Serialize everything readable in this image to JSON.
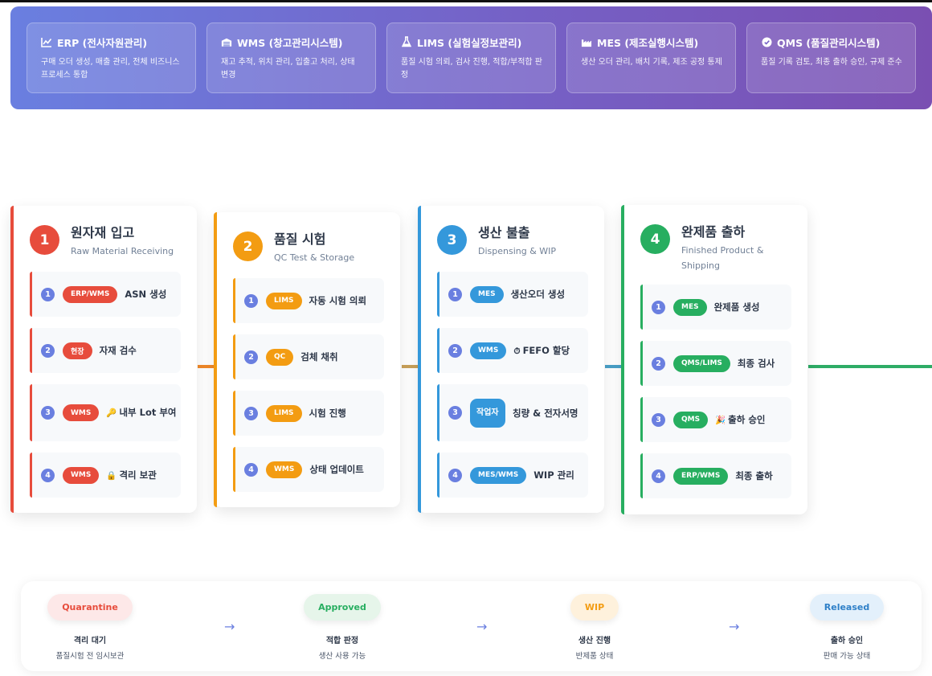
{
  "systems": [
    {
      "icon": "chart-line-icon",
      "title": "ERP (전사자원관리)",
      "desc": "구매 오더 생성, 매출 관리, 전체 비즈니스 프로세스 통합"
    },
    {
      "icon": "warehouse-icon",
      "title": "WMS (창고관리시스템)",
      "desc": "재고 추적, 위치 관리, 입출고 처리, 상태 변경"
    },
    {
      "icon": "flask-icon",
      "title": "LIMS (실험실정보관리)",
      "desc": "품질 시험 의뢰, 검사 진행, 적합/부적합 판정"
    },
    {
      "icon": "factory-icon",
      "title": "MES (제조실행시스템)",
      "desc": "생산 오더 관리, 배치 기록, 제조 공정 통제"
    },
    {
      "icon": "check-circle-icon",
      "title": "QMS (품질관리시스템)",
      "desc": "품질 기록 검토, 최종 출하 승인, 규제 준수"
    }
  ],
  "stages": [
    {
      "number": "1",
      "title": "원자재 입고",
      "subtitle": "Raw Material Receiving",
      "color": "#e74c3c",
      "steps": [
        {
          "n": "1",
          "badge": "ERP/WMS",
          "text": "ASN 생성",
          "emoji": ""
        },
        {
          "n": "2",
          "badge": "현장",
          "text": "자재 검수",
          "emoji": ""
        },
        {
          "n": "3",
          "badge": "WMS",
          "text": "내부 Lot 부여",
          "emoji": "🔑"
        },
        {
          "n": "4",
          "badge": "WMS",
          "text": "격리 보관",
          "emoji": "🔒"
        }
      ]
    },
    {
      "number": "2",
      "title": "품질 시험",
      "subtitle": "QC Test & Storage",
      "color": "#f39c12",
      "steps": [
        {
          "n": "1",
          "badge": "LIMS",
          "text": "자동 시험 의뢰",
          "emoji": ""
        },
        {
          "n": "2",
          "badge": "QC",
          "text": "검체 채취",
          "emoji": ""
        },
        {
          "n": "3",
          "badge": "LIMS",
          "text": "시험 진행",
          "emoji": ""
        },
        {
          "n": "4",
          "badge": "WMS",
          "text": "상태 업데이트",
          "emoji": ""
        }
      ]
    },
    {
      "number": "3",
      "title": "생산 불출",
      "subtitle": "Dispensing & WIP",
      "color": "#3498db",
      "steps": [
        {
          "n": "1",
          "badge": "MES",
          "text": "생산오더 생성",
          "emoji": ""
        },
        {
          "n": "2",
          "badge": "WMS",
          "text": "FEFO 할당",
          "emoji": "⏱"
        },
        {
          "n": "3",
          "badge": "작업자",
          "text": "칭량 & 전자서명",
          "emoji": ""
        },
        {
          "n": "4",
          "badge": "MES/WMS",
          "text": "WIP 관리",
          "emoji": ""
        }
      ]
    },
    {
      "number": "4",
      "title": "완제품 출하",
      "subtitle": "Finished Product & Shipping",
      "color": "#27ae60",
      "steps": [
        {
          "n": "1",
          "badge": "MES",
          "text": "완제품 생성",
          "emoji": ""
        },
        {
          "n": "2",
          "badge": "QMS/LIMS",
          "text": "최종 검사",
          "emoji": ""
        },
        {
          "n": "3",
          "badge": "QMS",
          "text": "출하 승인",
          "emoji": "🎉"
        },
        {
          "n": "4",
          "badge": "ERP/WMS",
          "text": "최종 출하",
          "emoji": ""
        }
      ]
    }
  ],
  "statuses": [
    {
      "pill": "Quarantine",
      "label": "격리 대기",
      "desc": "품질시험 전 임시보관",
      "bg": "#fde8e8",
      "fg": "#e74c3c"
    },
    {
      "pill": "Approved",
      "label": "적합 판정",
      "desc": "생산 사용 가능",
      "bg": "#e6f5ea",
      "fg": "#27ae60"
    },
    {
      "pill": "WIP",
      "label": "생산 진행",
      "desc": "반제품 상태",
      "bg": "#fef1dc",
      "fg": "#f39c12"
    },
    {
      "pill": "Released",
      "label": "출하 승인",
      "desc": "판매 가능 상태",
      "bg": "#e3f0fb",
      "fg": "#2f80c8"
    }
  ],
  "arrow": "→"
}
